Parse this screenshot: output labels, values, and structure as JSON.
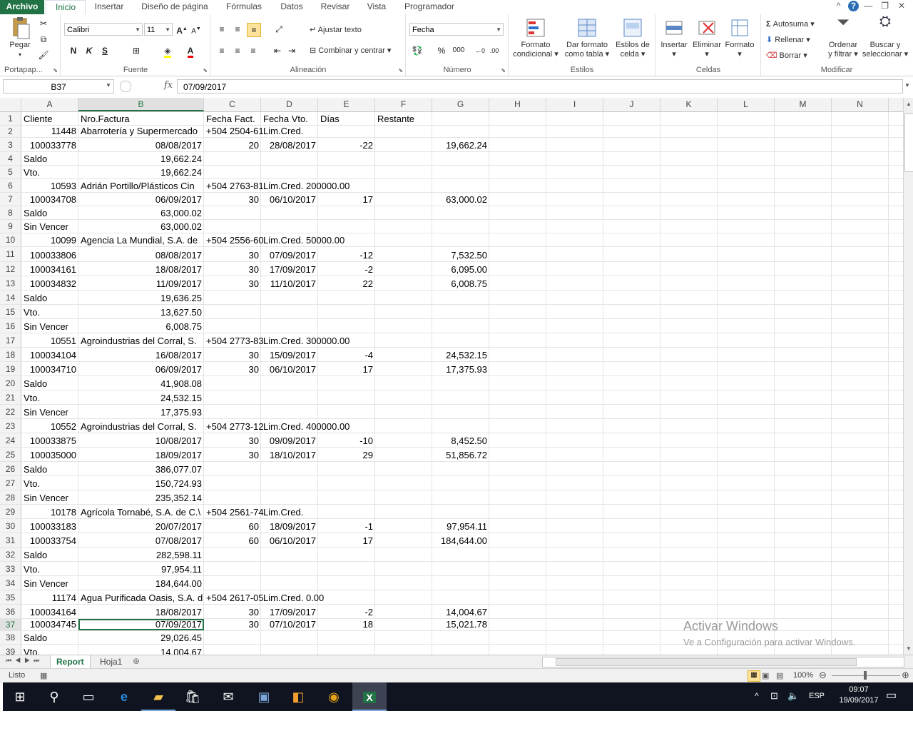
{
  "ribbon_tabs": [
    "Archivo",
    "Inicio",
    "Insertar",
    "Diseño de página",
    "Fórmulas",
    "Datos",
    "Revisar",
    "Vista",
    "Programador"
  ],
  "clipboard": {
    "paste": "Pegar",
    "group": "Portapap..."
  },
  "font": {
    "name": "Calibri",
    "size": "11",
    "group": "Fuente",
    "bold": "N",
    "italic": "K",
    "underline": "S"
  },
  "alignment": {
    "wrap": "Ajustar texto",
    "merge": "Combinar y centrar",
    "group": "Alineación"
  },
  "number": {
    "format": "Fecha",
    "group": "Número"
  },
  "styles": {
    "cond_fmt_1": "Formato",
    "cond_fmt_2": "condicional",
    "table_fmt_1": "Dar formato",
    "table_fmt_2": "como tabla",
    "cell_styles_1": "Estilos de",
    "cell_styles_2": "celda",
    "group": "Estilos"
  },
  "cells": {
    "insert": "Insertar",
    "delete": "Eliminar",
    "format": "Formato",
    "group": "Celdas"
  },
  "editing": {
    "autosum": "Autosuma",
    "fill": "Rellenar",
    "clear": "Borrar",
    "sort_1": "Ordenar",
    "sort_2": "y filtrar",
    "find_1": "Buscar y",
    "find_2": "seleccionar",
    "group": "Modificar"
  },
  "formula_bar": {
    "name_box": "B37",
    "fx": "fx",
    "value": "07/09/2017"
  },
  "columns": [
    "A",
    "B",
    "C",
    "D",
    "E",
    "F",
    "G",
    "H",
    "I",
    "J",
    "K",
    "L",
    "M",
    "N"
  ],
  "rows": [
    {
      "n": "1",
      "a": "Cliente",
      "b": "Nro.Factura",
      "c": "Fecha Fact.",
      "d": "Fecha Vto.",
      "e": "Días",
      "f": "Restante",
      "g": ""
    },
    {
      "n": "2",
      "a": "11448",
      "b": "Abarrotería y Supermercado",
      "c": "+504 2504-61",
      "d": "Lim.Cred.",
      "e": "",
      "f": "",
      "g": ""
    },
    {
      "n": "3",
      "a": "100033778",
      "b": "08/08/2017",
      "c": "20",
      "d": "28/08/2017",
      "e": "-22",
      "f": "",
      "g": "19,662.24"
    },
    {
      "n": "4",
      "a": "Saldo",
      "b": "19,662.24",
      "c": "",
      "d": "",
      "e": "",
      "f": "",
      "g": ""
    },
    {
      "n": "5",
      "a": "Vto.",
      "b": "19,662.24",
      "c": "",
      "d": "",
      "e": "",
      "f": "",
      "g": ""
    },
    {
      "n": "6",
      "a": "10593",
      "b": "Adrián Portillo/Plásticos Cin",
      "c": "+504 2763-81",
      "d": "Lim.Cred. 200000.00",
      "e": "",
      "f": "",
      "g": ""
    },
    {
      "n": "7",
      "a": "100034708",
      "b": "06/09/2017",
      "c": "30",
      "d": "06/10/2017",
      "e": "17",
      "f": "",
      "g": "63,000.02"
    },
    {
      "n": "8",
      "a": "Saldo",
      "b": "63,000.02",
      "c": "",
      "d": "",
      "e": "",
      "f": "",
      "g": ""
    },
    {
      "n": "9",
      "a": "Sin Vencer",
      "b": "63,000.02",
      "c": "",
      "d": "",
      "e": "",
      "f": "",
      "g": ""
    },
    {
      "n": "10",
      "a": "10099",
      "b": "Agencia La Mundial, S.A. de",
      "c": "+504 2556-60",
      "d": "Lim.Cred. 50000.00",
      "e": "",
      "f": "",
      "g": ""
    },
    {
      "n": "11",
      "a": "100033806",
      "b": "08/08/2017",
      "c": "30",
      "d": "07/09/2017",
      "e": "-12",
      "f": "",
      "g": "7,532.50"
    },
    {
      "n": "12",
      "a": "100034161",
      "b": "18/08/2017",
      "c": "30",
      "d": "17/09/2017",
      "e": "-2",
      "f": "",
      "g": "6,095.00"
    },
    {
      "n": "13",
      "a": "100034832",
      "b": "11/09/2017",
      "c": "30",
      "d": "11/10/2017",
      "e": "22",
      "f": "",
      "g": "6,008.75"
    },
    {
      "n": "14",
      "a": "Saldo",
      "b": "19,636.25",
      "c": "",
      "d": "",
      "e": "",
      "f": "",
      "g": ""
    },
    {
      "n": "15",
      "a": "Vto.",
      "b": "13,627.50",
      "c": "",
      "d": "",
      "e": "",
      "f": "",
      "g": ""
    },
    {
      "n": "16",
      "a": "Sin Vencer",
      "b": "6,008.75",
      "c": "",
      "d": "",
      "e": "",
      "f": "",
      "g": ""
    },
    {
      "n": "17",
      "a": "10551",
      "b": "Agroindustrias del Corral, S.",
      "c": "+504 2773-83",
      "d": "Lim.Cred. 300000.00",
      "e": "",
      "f": "",
      "g": ""
    },
    {
      "n": "18",
      "a": "100034104",
      "b": "16/08/2017",
      "c": "30",
      "d": "15/09/2017",
      "e": "-4",
      "f": "",
      "g": "24,532.15"
    },
    {
      "n": "19",
      "a": "100034710",
      "b": "06/09/2017",
      "c": "30",
      "d": "06/10/2017",
      "e": "17",
      "f": "",
      "g": "17,375.93"
    },
    {
      "n": "20",
      "a": "Saldo",
      "b": "41,908.08",
      "c": "",
      "d": "",
      "e": "",
      "f": "",
      "g": ""
    },
    {
      "n": "21",
      "a": "Vto.",
      "b": "24,532.15",
      "c": "",
      "d": "",
      "e": "",
      "f": "",
      "g": ""
    },
    {
      "n": "22",
      "a": "Sin Vencer",
      "b": "17,375.93",
      "c": "",
      "d": "",
      "e": "",
      "f": "",
      "g": ""
    },
    {
      "n": "23",
      "a": "10552",
      "b": "Agroindustrias del Corral, S.",
      "c": "+504 2773-12",
      "d": "Lim.Cred. 400000.00",
      "e": "",
      "f": "",
      "g": ""
    },
    {
      "n": "24",
      "a": "100033875",
      "b": "10/08/2017",
      "c": "30",
      "d": "09/09/2017",
      "e": "-10",
      "f": "",
      "g": "8,452.50"
    },
    {
      "n": "25",
      "a": "100035000",
      "b": "18/09/2017",
      "c": "30",
      "d": "18/10/2017",
      "e": "29",
      "f": "",
      "g": "51,856.72"
    },
    {
      "n": "26",
      "a": "Saldo",
      "b": "386,077.07",
      "c": "",
      "d": "",
      "e": "",
      "f": "",
      "g": ""
    },
    {
      "n": "27",
      "a": "Vto.",
      "b": "150,724.93",
      "c": "",
      "d": "",
      "e": "",
      "f": "",
      "g": ""
    },
    {
      "n": "28",
      "a": "Sin Vencer",
      "b": "235,352.14",
      "c": "",
      "d": "",
      "e": "",
      "f": "",
      "g": ""
    },
    {
      "n": "29",
      "a": "10178",
      "b": "Agrícola Tornabé, S.A. de C.\\",
      "c": "+504 2561-74",
      "d": "Lim.Cred.",
      "e": "",
      "f": "",
      "g": ""
    },
    {
      "n": "30",
      "a": "100033183",
      "b": "20/07/2017",
      "c": "60",
      "d": "18/09/2017",
      "e": "-1",
      "f": "",
      "g": "97,954.11"
    },
    {
      "n": "31",
      "a": "100033754",
      "b": "07/08/2017",
      "c": "60",
      "d": "06/10/2017",
      "e": "17",
      "f": "",
      "g": "184,644.00"
    },
    {
      "n": "32",
      "a": "Saldo",
      "b": "282,598.11",
      "c": "",
      "d": "",
      "e": "",
      "f": "",
      "g": ""
    },
    {
      "n": "33",
      "a": "Vto.",
      "b": "97,954.11",
      "c": "",
      "d": "",
      "e": "",
      "f": "",
      "g": ""
    },
    {
      "n": "34",
      "a": "Sin Vencer",
      "b": "184,644.00",
      "c": "",
      "d": "",
      "e": "",
      "f": "",
      "g": ""
    },
    {
      "n": "35",
      "a": "11174",
      "b": "Agua Purificada Oasis, S.A. d",
      "c": "+504 2617-05",
      "d": "Lim.Cred. 0.00",
      "e": "",
      "f": "",
      "g": ""
    },
    {
      "n": "36",
      "a": "100034164",
      "b": "18/08/2017",
      "c": "30",
      "d": "17/09/2017",
      "e": "-2",
      "f": "",
      "g": "14,004.67"
    },
    {
      "n": "37",
      "a": "100034745",
      "b": "07/09/2017",
      "c": "30",
      "d": "07/10/2017",
      "e": "18",
      "f": "",
      "g": "15,021.78"
    },
    {
      "n": "38",
      "a": "Saldo",
      "b": "29,026.45",
      "c": "",
      "d": "",
      "e": "",
      "f": "",
      "g": ""
    },
    {
      "n": "39",
      "a": "Vto.",
      "b": "14,004.67",
      "c": "",
      "d": "",
      "e": "",
      "f": "",
      "g": ""
    }
  ],
  "selected_row": "37",
  "selected_col": "B",
  "sheet_tabs": [
    "Report",
    "Hoja1"
  ],
  "status": {
    "ready": "Listo",
    "zoom": "100%"
  },
  "watermark": {
    "line1": "Activar Windows",
    "line2": "Ve a Configuración para activar Windows."
  },
  "taskbar": {
    "lang": "ESP",
    "time": "09:07",
    "date": "19/09/2017"
  },
  "colors": {
    "excel_green": "#217346",
    "taskbar": "#101420",
    "selection": "#217346"
  }
}
